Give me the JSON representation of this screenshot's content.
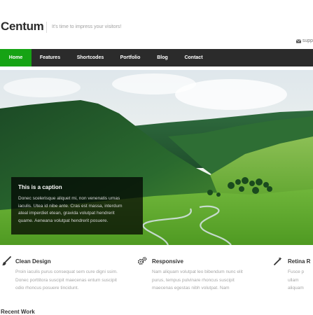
{
  "site": {
    "logo": "Centum",
    "tagline": "It's time to impress your visitors!",
    "support_text": "supp"
  },
  "nav": {
    "items": [
      {
        "label": "Home",
        "active": true
      },
      {
        "label": "Features",
        "active": false
      },
      {
        "label": "Shortcodes",
        "active": false
      },
      {
        "label": "Portfolio",
        "active": false
      },
      {
        "label": "Blog",
        "active": false
      },
      {
        "label": "Contact",
        "active": false
      }
    ]
  },
  "slider": {
    "caption_title": "This is a caption",
    "caption_lines": [
      "Donec scelerisque aliquet mi, non venenatis urnas",
      "iaculis. Utea id nibe ante. Cras est massa, interdum",
      "ateal imperdiet etean, gravida volutpat hendrerit",
      "quame. Aeneana volutpat hendrerit posuere."
    ]
  },
  "features": [
    {
      "icon": "brush-icon",
      "title": "Clean Design",
      "lines": [
        "Proin iaculis purus consequat sem cure digni ssim.",
        "Donec porttitora suscipit maecenas entum suscipit",
        "odio rhoncus posuere tincidunt."
      ]
    },
    {
      "icon": "gears-icon",
      "title": "Responsive",
      "lines": [
        "Nam aliquam volutpat leo bibendum nunc elit",
        "purus, tempus pulvinare rhoncus suscipit",
        "maecenas egestas nibh volutpat. Nam"
      ]
    },
    {
      "icon": "magic-wand-icon",
      "title": "Retina R",
      "lines": [
        "Fusce p",
        "ullam",
        "aliquam"
      ]
    }
  ],
  "section": {
    "recent_work": "Recent Work"
  },
  "colors": {
    "nav_background": "#2b2b2b",
    "accent_green": "#16a314",
    "caption_background": "rgba(0,0,0,0.72)"
  }
}
